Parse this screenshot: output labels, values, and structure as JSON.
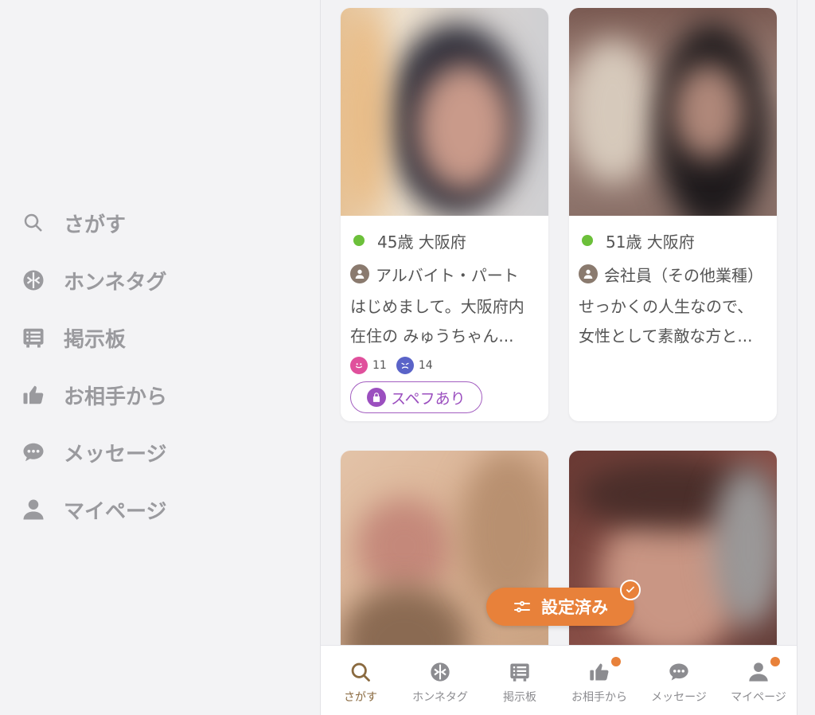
{
  "side_nav": {
    "items": [
      {
        "label": "さがす",
        "icon": "search-icon"
      },
      {
        "label": "ホンネタグ",
        "icon": "tag-icon"
      },
      {
        "label": "掲示板",
        "icon": "board-icon"
      },
      {
        "label": "お相手から",
        "icon": "thumbs-up-icon"
      },
      {
        "label": "メッセージ",
        "icon": "message-icon"
      },
      {
        "label": "マイページ",
        "icon": "person-icon"
      }
    ]
  },
  "cards": [
    {
      "age_location": "45歳 大阪府",
      "online_color": "#6cc03a",
      "job": "アルバイト・パート",
      "intro": "はじめまして。大阪府内在住の みゅうちゃん...",
      "likes": "11",
      "dislikes": "14",
      "badge": "スペフあり"
    },
    {
      "age_location": "51歳 大阪府",
      "online_color": "#6cc03a",
      "job": "会社員（その他業種）",
      "intro": "せっかくの人生なので、女性として素敵な方と..."
    },
    {},
    {}
  ],
  "filter_pill": {
    "label": "設定済み",
    "color": "#e8813a"
  },
  "tabbar": {
    "tabs": [
      {
        "label": "さがす",
        "icon": "search-icon",
        "active": true
      },
      {
        "label": "ホンネタグ",
        "icon": "tag-icon"
      },
      {
        "label": "掲示板",
        "icon": "board-icon"
      },
      {
        "label": "お相手から",
        "icon": "thumbs-up-icon",
        "notification": true
      },
      {
        "label": "メッセージ",
        "icon": "message-icon"
      },
      {
        "label": "マイページ",
        "icon": "person-icon",
        "notification": true
      }
    ]
  }
}
